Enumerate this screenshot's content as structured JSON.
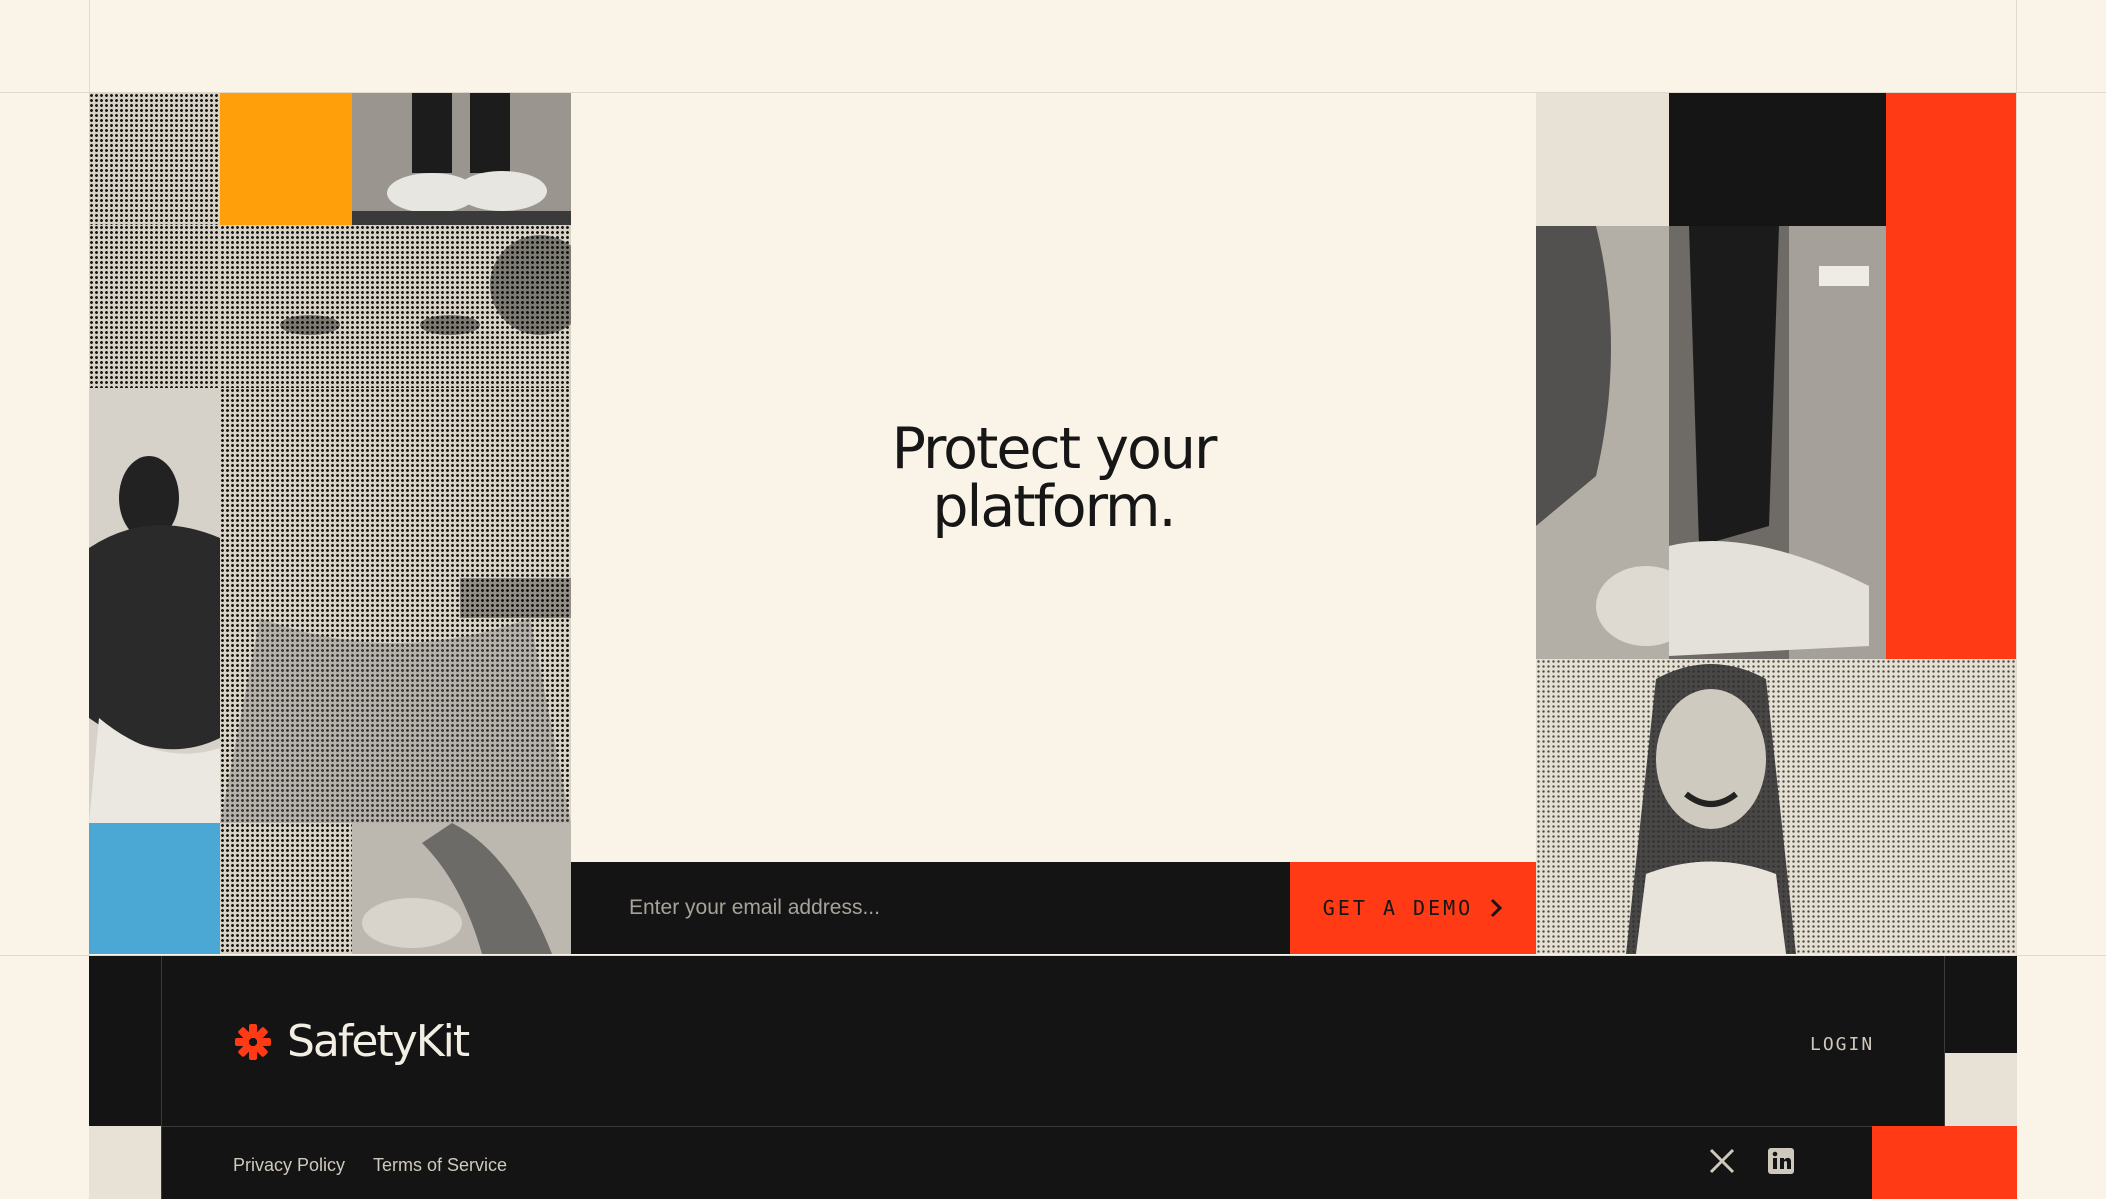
{
  "hero": {
    "title": "Protect your platform."
  },
  "signup": {
    "email_placeholder": "Enter your email address...",
    "cta_label": "GET A DEMO"
  },
  "footer": {
    "brand": "SafetyKit",
    "login_label": "LOGIN",
    "links": [
      "Privacy Policy",
      "Terms of Service"
    ],
    "social": [
      {
        "name": "x-icon"
      },
      {
        "name": "linkedin-icon"
      }
    ]
  },
  "colors": {
    "background": "#faf4e8",
    "dark": "#141414",
    "accent_red": "#ff3a14",
    "accent_orange": "#ffa00a",
    "accent_blue": "#4ba7d4",
    "beige_tile": "#e8e1d6"
  }
}
